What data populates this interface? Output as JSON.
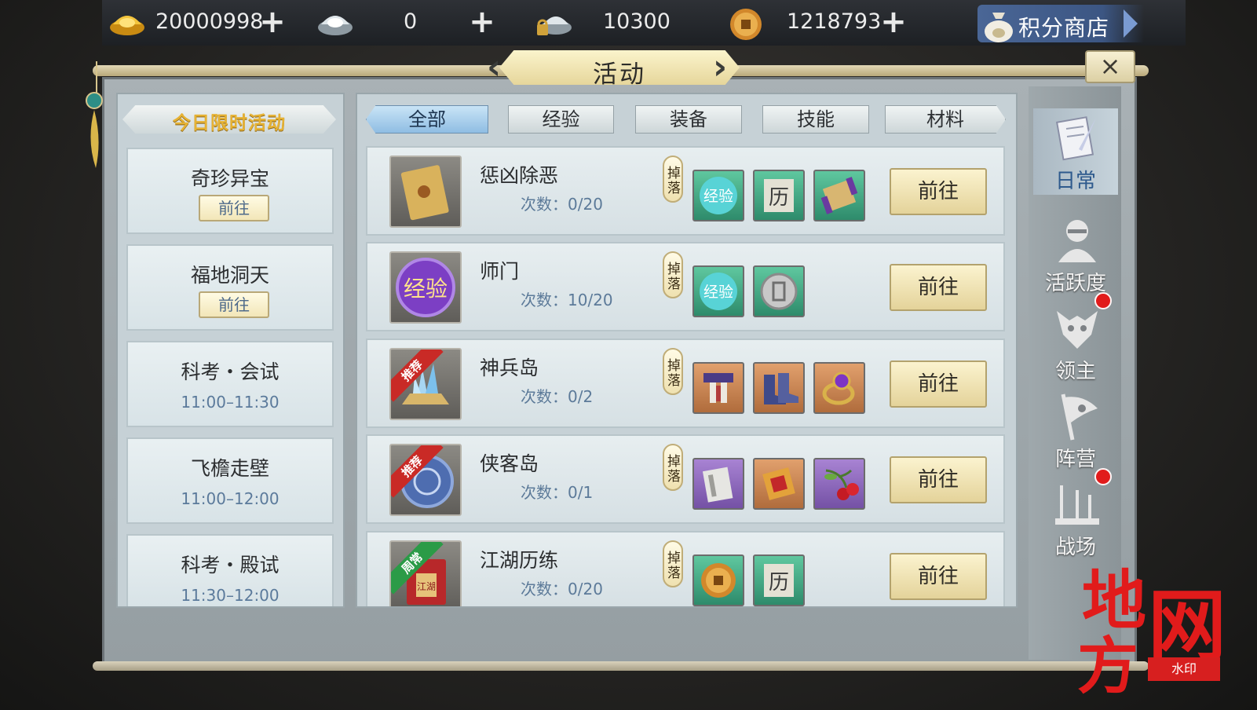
{
  "currency_bar": {
    "items": [
      {
        "icon": "gold-ingot-icon",
        "value": "20000998",
        "has_plus": true
      },
      {
        "icon": "silver-ingot-icon",
        "value": "0",
        "has_plus": true
      },
      {
        "icon": "bound-silver-icon",
        "value": "10300",
        "has_plus": false
      },
      {
        "icon": "copper-coin-icon",
        "value": "1218793",
        "has_plus": true
      }
    ],
    "shop_label": "积分商店"
  },
  "window": {
    "title": "活动",
    "close_label": "×"
  },
  "left": {
    "header": "今日限时活动",
    "go_label": "前往",
    "cards": [
      {
        "name": "奇珍异宝",
        "time": "",
        "has_go": true
      },
      {
        "name": "福地洞天",
        "time": "",
        "has_go": true
      },
      {
        "name": "科考・会试",
        "time": "11:00–11:30",
        "has_go": false
      },
      {
        "name": "飞檐走壁",
        "time": "11:00–12:00",
        "has_go": false
      },
      {
        "name": "科考・殿试",
        "time": "11:30–12:00",
        "has_go": false
      }
    ]
  },
  "tabs": [
    {
      "label": "全部",
      "active": true
    },
    {
      "label": "经验",
      "active": false
    },
    {
      "label": "装备",
      "active": false
    },
    {
      "label": "技能",
      "active": false
    },
    {
      "label": "材料",
      "active": false
    }
  ],
  "activities": {
    "count_label": "次数：",
    "drop_label": "掉落",
    "go_label": "前往",
    "icon_exp_text": "经验",
    "icon_li_text": "历",
    "items": [
      {
        "name": "惩凶除恶",
        "count": "0/20",
        "icon": "scroll-letter-icon",
        "ribbon": "",
        "rewards": [
          "exp-orb-icon",
          "li-token-icon",
          "purple-scroll-icon"
        ]
      },
      {
        "name": "师门",
        "count": "10/20",
        "icon": "exp-orb-icon",
        "ribbon": "",
        "rewards": [
          "exp-orb-icon",
          "sect-badge-icon"
        ]
      },
      {
        "name": "神兵岛",
        "count": "0/2",
        "icon": "crystal-altar-icon",
        "ribbon": "推荐",
        "rewards": [
          "belt-icon",
          "boots-icon",
          "ring-icon"
        ]
      },
      {
        "name": "侠客岛",
        "count": "0/1",
        "icon": "blue-medallion-icon",
        "ribbon": "推荐",
        "rewards": [
          "book-icon",
          "red-scroll-icon",
          "cherry-icon"
        ]
      },
      {
        "name": "江湖历练",
        "count": "0/20",
        "icon": "red-envelope-icon",
        "ribbon": "周常",
        "rewards": [
          "copper-coin-icon",
          "li-token-icon"
        ]
      }
    ],
    "envelope_text": "江湖"
  },
  "side_nav": [
    {
      "label": "日常",
      "icon": "notebook-quill-icon",
      "active": true,
      "badge": false
    },
    {
      "label": "活跃度",
      "icon": "figure-bust-icon",
      "active": false,
      "badge": false
    },
    {
      "label": "领主",
      "icon": "demon-mask-icon",
      "active": false,
      "badge": true
    },
    {
      "label": "阵营",
      "icon": "flag-icon",
      "active": false,
      "badge": false
    },
    {
      "label": "战场",
      "icon": "crossed-weapons-icon",
      "active": false,
      "badge": true
    }
  ],
  "watermark": {
    "big": [
      "地",
      "网",
      "方"
    ],
    "small": "水印"
  },
  "colors": {
    "accent_blue": "#2e5a8d",
    "gold_text": "#e6b234",
    "badge_red": "#e11b1b"
  }
}
